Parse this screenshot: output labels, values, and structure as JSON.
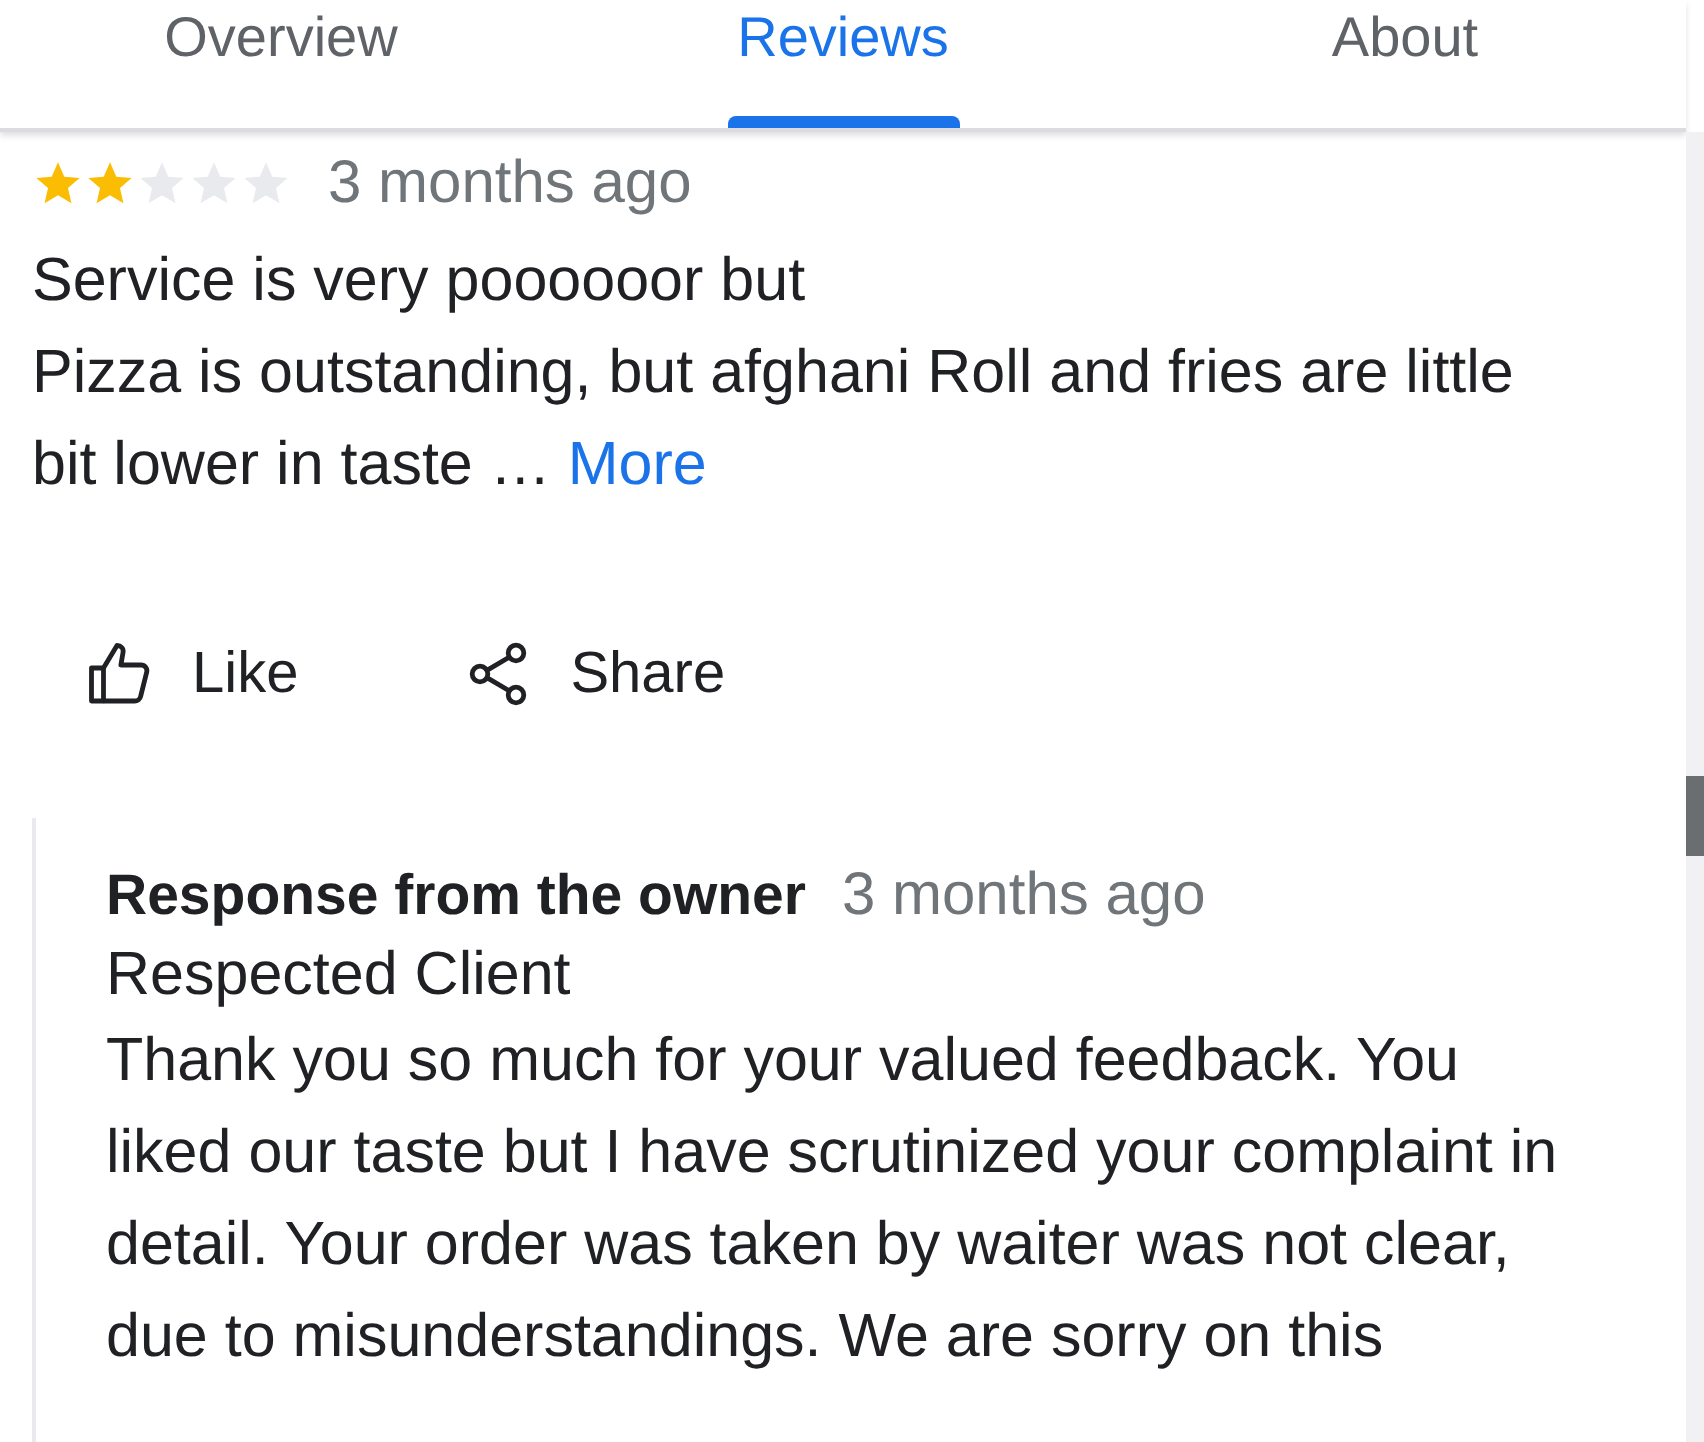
{
  "tabs": [
    {
      "label": "Overview",
      "selected": false
    },
    {
      "label": "Reviews",
      "selected": true
    },
    {
      "label": "About",
      "selected": false
    }
  ],
  "review": {
    "stars": 2,
    "time": "3 months ago",
    "text": "Service is very poooooor but\nPizza is outstanding, but afghani Roll and fries are little bit lower in taste …",
    "more": "More"
  },
  "actions": [
    {
      "kind": "like",
      "label": "Like"
    },
    {
      "kind": "share",
      "label": "Share"
    }
  ],
  "owner_response": {
    "title": "Response from the owner",
    "time": "3 months ago",
    "greeting": "Respected Client",
    "text": "Thank you so much for your valued feedback. You liked our taste but I have scrutinized your complaint in detail. Your order was taken by waiter was not clear, due to misunderstandings. We are sorry on this"
  }
}
